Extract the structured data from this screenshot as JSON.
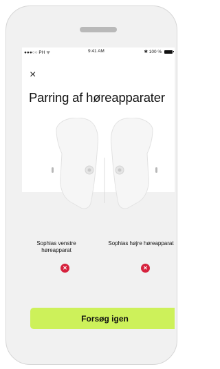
{
  "status": {
    "carrier": "●●●○○ PH",
    "wifi": "ᯤ",
    "time": "9:41 AM",
    "bluetooth": "✱",
    "battery": "100 %"
  },
  "header": {
    "close_icon": "×",
    "title": "Parring af høreapparater"
  },
  "devices": {
    "left_label": "Sophias venstre høreapparat",
    "right_label": "Sophias højre høreapparat",
    "left_status_icon": "✕",
    "right_status_icon": "✕",
    "status": "error"
  },
  "actions": {
    "retry_label": "Forsøg igen"
  },
  "colors": {
    "accent_button": "#cdf15a",
    "error": "#d6223d",
    "background_band": "#f1f1f1"
  }
}
